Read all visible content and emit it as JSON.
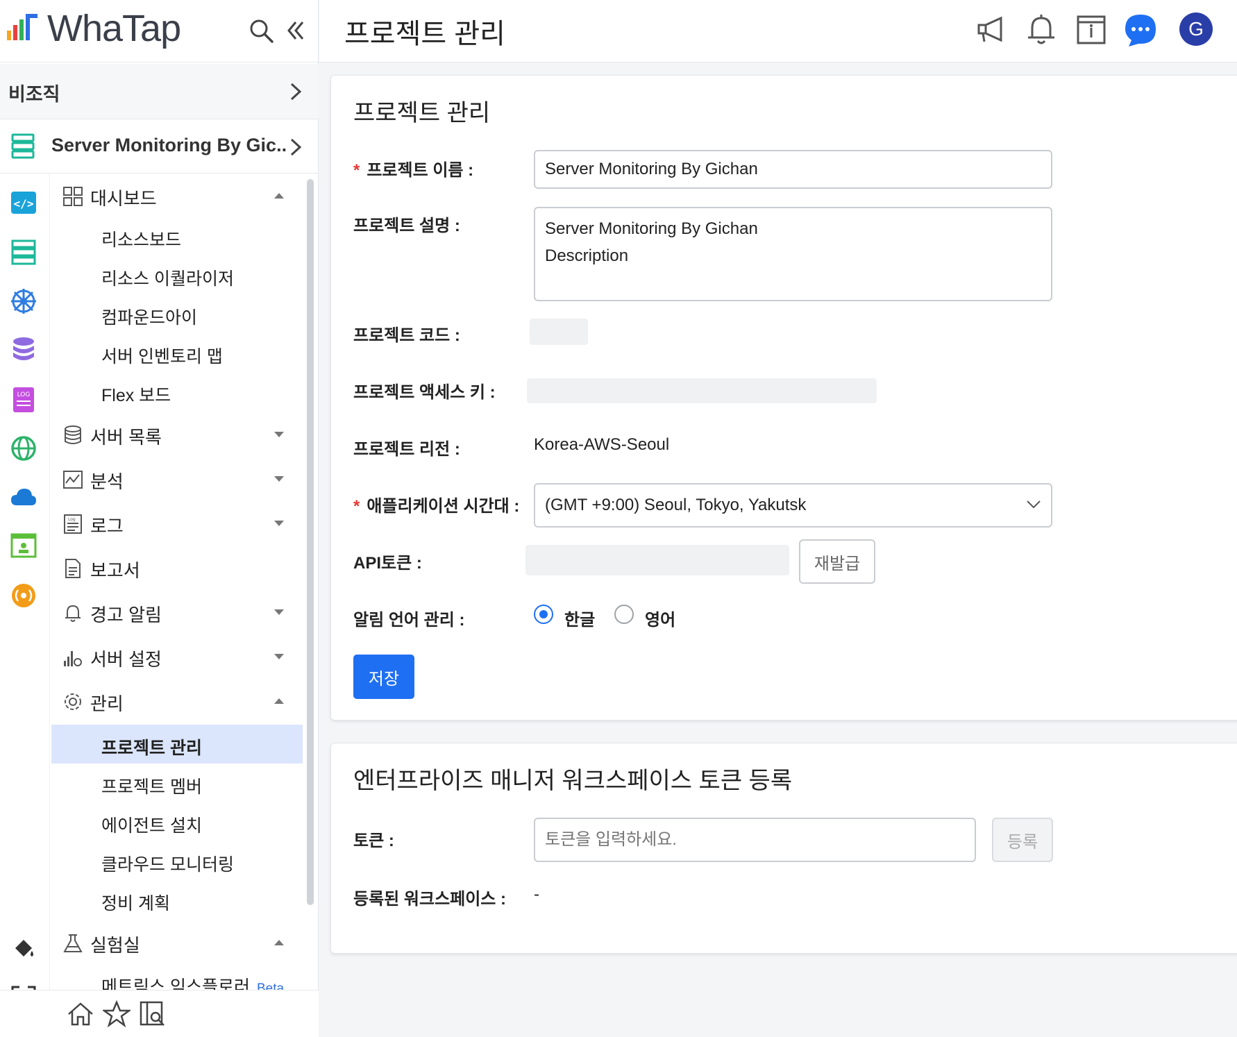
{
  "app": {
    "brand": "WhaTap",
    "accent": "#1f6ff2"
  },
  "sidebar": {
    "org_label": "비조직",
    "project_name": "Server Monitoring By Gic...",
    "menu": {
      "dashboard": {
        "label": "대시보드",
        "items": [
          "리소스보드",
          "리소스 이퀄라이저",
          "컴파운드아이",
          "서버 인벤토리 맵",
          "Flex 보드"
        ]
      },
      "server_list": "서버 목록",
      "analysis": "분석",
      "log": "로그",
      "report": "보고서",
      "alert": "경고 알림",
      "server_settings": "서버 설정",
      "manage": {
        "label": "관리",
        "items": [
          "프로젝트 관리",
          "프로젝트 멤버",
          "에이전트 설치",
          "클라우드 모니터링",
          "정비 계획"
        ]
      },
      "lab": {
        "label": "실험실",
        "items": [
          "메트릭스 익스플로러"
        ],
        "beta": "Beta"
      }
    }
  },
  "header": {
    "title": "프로젝트 관리",
    "avatar_letter": "G"
  },
  "project_panel": {
    "title": "프로젝트 관리",
    "required_mark": "*",
    "name_label": "프로젝트 이름 :",
    "name_value": "Server Monitoring By Gichan",
    "desc_label": "프로젝트 설명 :",
    "desc_value": "Server Monitoring By Gichan\nDescription",
    "code_label": "프로젝트 코드 :",
    "access_key_label": "프로젝트 액세스 키 :",
    "region_label": "프로젝트 리전 :",
    "region_value": "Korea-AWS-Seoul",
    "timezone_label": "애플리케이션 시간대 :",
    "timezone_value": "(GMT +9:00) Seoul, Tokyo, Yakutsk",
    "api_token_label": "API토큰 :",
    "reissue_label": "재발급",
    "alert_lang_label": "알림 언어 관리 :",
    "lang_korean": "한글",
    "lang_english": "영어",
    "save_label": "저장"
  },
  "token_panel": {
    "title": "엔터프라이즈 매니저 워크스페이스 토큰 등록",
    "token_label": "토큰 :",
    "token_placeholder": "토큰을 입력하세요.",
    "register_label": "등록",
    "workspace_label": "등록된 워크스페이스 :",
    "workspace_value": "-"
  }
}
